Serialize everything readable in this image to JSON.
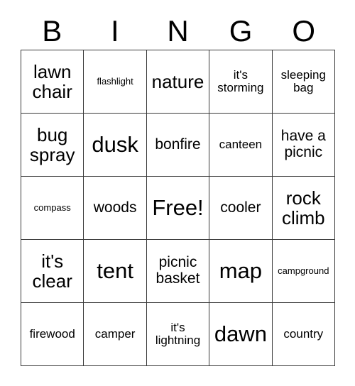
{
  "card": {
    "title": "BINGO",
    "header_letters": [
      "B",
      "I",
      "N",
      "G",
      "O"
    ],
    "columns": 5,
    "rows": 5,
    "border_color": "#3a3a3a",
    "background_color": "#ffffff",
    "text_color": "#000000",
    "free_space": "Free!",
    "free_space_position": "center",
    "cells": [
      [
        {
          "text": "lawn\nchair",
          "size": "l"
        },
        {
          "text": "flashlight",
          "size": "xs"
        },
        {
          "text": "nature",
          "size": "l"
        },
        {
          "text": "it's\nstorming",
          "size": "s"
        },
        {
          "text": "sleeping\nbag",
          "size": "s"
        }
      ],
      [
        {
          "text": "bug\nspray",
          "size": "l"
        },
        {
          "text": "dusk",
          "size": "xl"
        },
        {
          "text": "bonfire",
          "size": "m"
        },
        {
          "text": "canteen",
          "size": "s"
        },
        {
          "text": "have a\npicnic",
          "size": "m"
        }
      ],
      [
        {
          "text": "compass",
          "size": "xs"
        },
        {
          "text": "woods",
          "size": "m"
        },
        {
          "text": "Free!",
          "size": "xl"
        },
        {
          "text": "cooler",
          "size": "m"
        },
        {
          "text": "rock\nclimb",
          "size": "l"
        }
      ],
      [
        {
          "text": "it's\nclear",
          "size": "l"
        },
        {
          "text": "tent",
          "size": "xl"
        },
        {
          "text": "picnic\nbasket",
          "size": "m"
        },
        {
          "text": "map",
          "size": "xl"
        },
        {
          "text": "campground",
          "size": "xs"
        }
      ],
      [
        {
          "text": "firewood",
          "size": "s"
        },
        {
          "text": "camper",
          "size": "s"
        },
        {
          "text": "it's\nlightning",
          "size": "s"
        },
        {
          "text": "dawn",
          "size": "xl"
        },
        {
          "text": "country",
          "size": "s"
        }
      ]
    ]
  }
}
